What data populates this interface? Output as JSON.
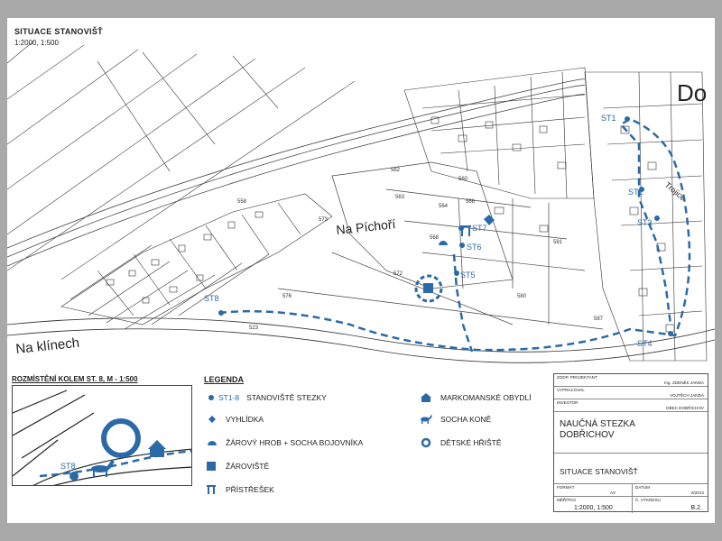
{
  "title": "SITUACE STANOVIŠŤ",
  "scale": "1:2000, 1:500",
  "map": {
    "locality_labels": [
      "Na Píchoří",
      "Na klínech",
      "Do",
      "Trojice"
    ],
    "stations": [
      "ST1",
      "ST2",
      "ST3",
      "ST4",
      "ST5",
      "ST6",
      "ST7",
      "ST8"
    ],
    "colors": {
      "trail": "#2a6aa8",
      "station": "#2a6aa8",
      "lines": "#333333"
    },
    "parcel_numbers": [
      "573",
      "572",
      "576",
      "562",
      "563",
      "564",
      "566",
      "568",
      "580",
      "560",
      "581",
      "558",
      "523",
      "587"
    ]
  },
  "inset": {
    "title": "ROZMÍSTĚNÍ KOLEM ST. 8, M - 1:500",
    "station_label": "ST8"
  },
  "legend": {
    "title": "LEGENDA",
    "items_left": [
      {
        "icon": "station-dot-icon",
        "label": "STANOVIŠTĚ STEZKY",
        "prefix": "ST1-8"
      },
      {
        "icon": "viewpoint-icon",
        "label": "VYHLÍDKA"
      },
      {
        "icon": "grave-icon",
        "label": "ŽÁROVÝ HROB + SOCHA BOJOVNÍKA"
      },
      {
        "icon": "cremation-site-icon",
        "label": "ŽÁROVIŠTĚ"
      },
      {
        "icon": "shelter-icon",
        "label": "PŘÍSTŘEŠEK"
      }
    ],
    "items_right": [
      {
        "icon": "house-icon",
        "label": "MARKOMANSKÉ OBYDLÍ"
      },
      {
        "icon": "horse-icon",
        "label": "SOCHA KONĚ"
      },
      {
        "icon": "playground-icon",
        "label": "DĚTSKÉ HŘIŠTĚ"
      }
    ]
  },
  "titleblock": {
    "project_lead_label": "ZODP. PROJEKTANT",
    "project_lead": "Ing. ZDENĚK JANDA",
    "drawn_label": "VYPRACOVAL",
    "drawn": "VOJTĚCH JANDA",
    "investor_label": "INVESTOR",
    "investor": "OBEC DOBŘICHOV",
    "project_name_1": "NAUČNÁ STEZKA",
    "project_name_2": "DOBŘICHOV",
    "drawing_name": "SITUACE STANOVIŠŤ",
    "format_label": "FORMÁT",
    "format": "A3",
    "date_label": "DATUM",
    "date": "8/2013",
    "scale_label": "MĚŘÍTKO",
    "scale": "1:2000, 1:500",
    "drawing_no_label": "Č. VÝKRESU",
    "drawing_no": "B.2."
  }
}
